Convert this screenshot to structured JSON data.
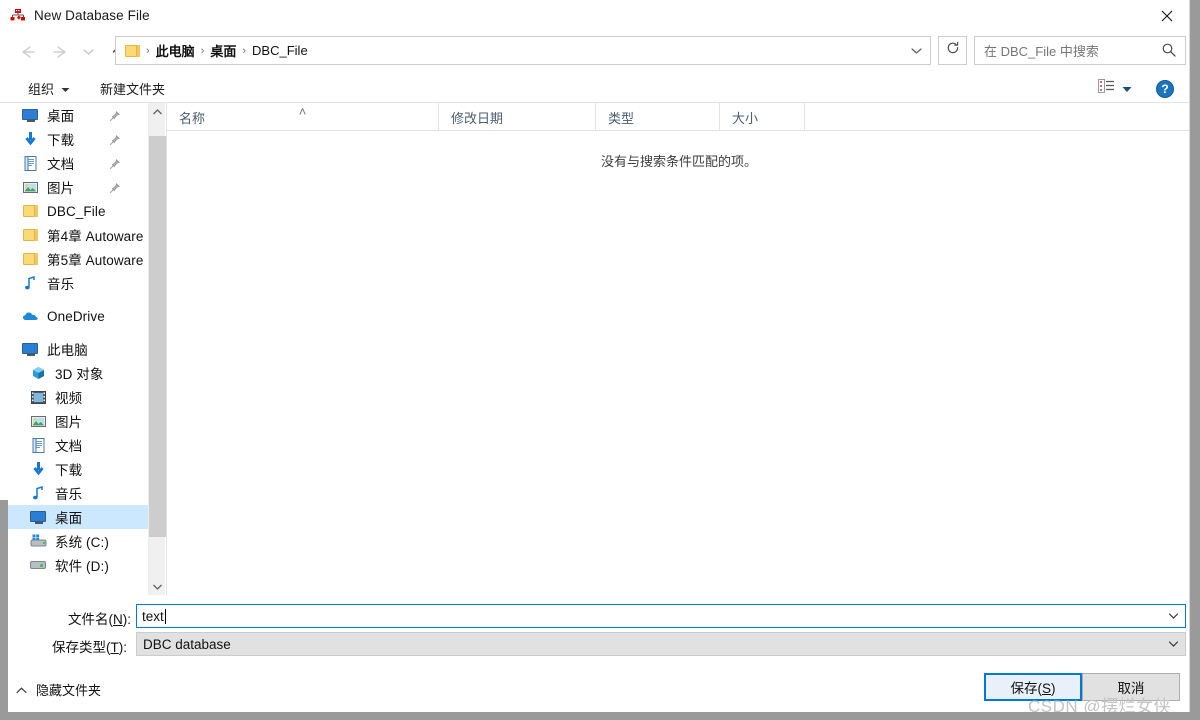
{
  "window": {
    "title": "New Database File",
    "icon": "database-diagram-icon",
    "close_label": "✕"
  },
  "nav": {
    "back_icon": "arrow-left-icon",
    "forward_icon": "arrow-right-icon",
    "recent_icon": "chevron-down-icon",
    "up_icon": "arrow-up-icon",
    "breadcrumbs": [
      "此电脑",
      "桌面",
      "DBC_File"
    ],
    "separator": "›",
    "address_dropdown_icon": "chevron-down-icon",
    "refresh_icon": "refresh-icon",
    "refresh_label": "↻"
  },
  "search": {
    "placeholder": "在 DBC_File 中搜索",
    "icon": "search-icon"
  },
  "toolbar": {
    "organize_label": "组织",
    "organize_caret": "▾",
    "new_folder_label": "新建文件夹",
    "view_icon": "view-options-icon",
    "view_caret": "▾",
    "help_icon": "help-icon",
    "help_label": "?"
  },
  "sidebar": {
    "quick_access": [
      {
        "label": "桌面",
        "icon": "desktop-icon",
        "pinned": true
      },
      {
        "label": "下载",
        "icon": "downloads-icon",
        "pinned": true
      },
      {
        "label": "文档",
        "icon": "documents-icon",
        "pinned": true
      },
      {
        "label": "图片",
        "icon": "pictures-icon",
        "pinned": true
      },
      {
        "label": "DBC_File",
        "icon": "folder-icon",
        "pinned": false
      },
      {
        "label": "第4章 Autoware",
        "icon": "folder-icon",
        "pinned": false
      },
      {
        "label": "第5章 Autoware",
        "icon": "folder-icon",
        "pinned": false
      },
      {
        "label": "音乐",
        "icon": "music-icon",
        "pinned": false
      }
    ],
    "onedrive": {
      "label": "OneDrive",
      "icon": "cloud-icon"
    },
    "this_pc": {
      "label": "此电脑",
      "icon": "computer-icon"
    },
    "this_pc_children": [
      {
        "label": "3D 对象",
        "icon": "3d-objects-icon"
      },
      {
        "label": "视频",
        "icon": "videos-icon"
      },
      {
        "label": "图片",
        "icon": "pictures-icon"
      },
      {
        "label": "文档",
        "icon": "documents-icon"
      },
      {
        "label": "下载",
        "icon": "downloads-icon"
      },
      {
        "label": "音乐",
        "icon": "music-icon"
      },
      {
        "label": "桌面",
        "icon": "desktop-icon",
        "selected": true
      },
      {
        "label": "系统 (C:)",
        "icon": "system-drive-icon"
      },
      {
        "label": "软件 (D:)",
        "icon": "drive-icon"
      }
    ],
    "scroll_up_icon": "chevron-up-icon",
    "scroll_down_icon": "chevron-down-icon"
  },
  "filelist": {
    "columns": [
      {
        "label": "名称",
        "sorted": true,
        "sort_mark": "˄"
      },
      {
        "label": "修改日期",
        "sorted": false
      },
      {
        "label": "类型",
        "sorted": false
      },
      {
        "label": "大小",
        "sorted": false
      }
    ],
    "rows": [],
    "empty_message": "没有与搜索条件匹配的项。"
  },
  "form": {
    "filename_label_pre": "文件名(",
    "filename_label_key": "N",
    "filename_label_post": "):",
    "filename_value": "text",
    "filetype_label_pre": "保存类型(",
    "filetype_label_key": "T",
    "filetype_label_post": "):",
    "filetype_value": "DBC database",
    "dropdown_icon": "chevron-down-icon"
  },
  "footer": {
    "save_pre": "保存(",
    "save_key": "S",
    "save_post": ")",
    "cancel_label": "取消",
    "hide_folders_label": "隐藏文件夹",
    "hide_folders_icon": "chevron-up-icon"
  },
  "watermark": {
    "text": "CSDN @摆烂女侠"
  },
  "colors": {
    "accent": "#0078d7",
    "selection": "#cce8ff",
    "folder": "#fbd975",
    "header_text": "#4a5d70",
    "frame": "#9a9a9a"
  }
}
